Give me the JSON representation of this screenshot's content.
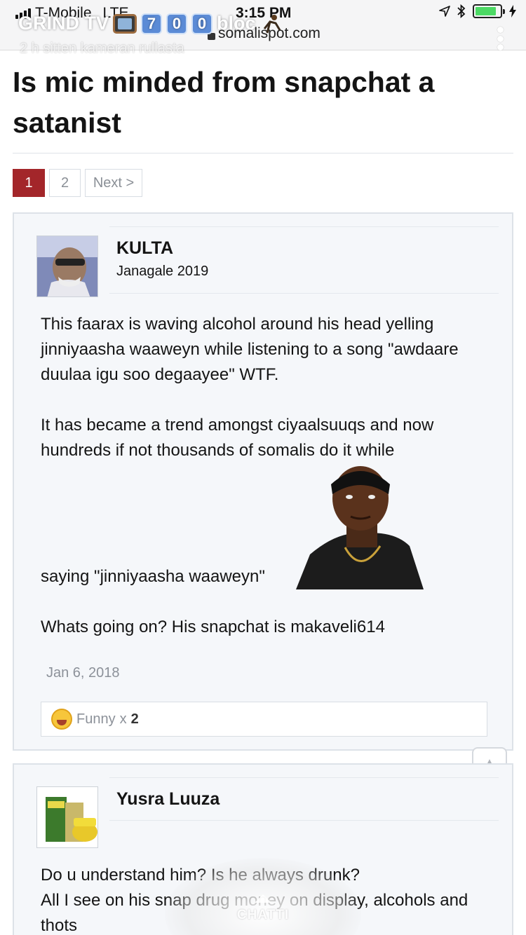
{
  "status_bar": {
    "carrier": "T-Mobile",
    "network": "LTE",
    "time": "3:15 PM",
    "battery_level": 0.85,
    "icons": [
      "location-arrow-icon",
      "bluetooth-icon",
      "battery-icon",
      "charging-bolt-icon"
    ]
  },
  "browser": {
    "url": "somalispot.com",
    "menu_icon": "more-dots-icon"
  },
  "snap_overlay": {
    "title_prefix": "GRIND TV",
    "digits": [
      "7",
      "0",
      "0"
    ],
    "title_suffix": "bloc",
    "subtitle": "2 h sitten kameran rullasta"
  },
  "thread": {
    "title": "Is mic minded from snapchat a satanist"
  },
  "pager": {
    "pages": [
      "1",
      "2"
    ],
    "current": "1",
    "next_label": "Next >"
  },
  "posts": [
    {
      "username": "KULTA",
      "user_title": "Janagale 2019",
      "paragraphs": [
        "This faarax is waving alcohol around his head yelling jinniyaasha waaweyn while listening to a song \"awdaare duulaa igu soo degaayee\" WTF.",
        "It has became a trend amongst ciyaalsuuqs and now hundreds if not thousands of somalis do it while",
        "saying \"jinniyaasha waaweyn\"",
        "Whats going on? His snapchat is makaveli614"
      ],
      "date": "Jan 6, 2018",
      "reaction": {
        "label": "Funny",
        "multiplier": "x",
        "count": "2"
      }
    },
    {
      "username": "Yusra Luuza",
      "user_title": "",
      "paragraphs": [
        "Do u understand him? Is he always drunk?",
        "All I see on his snap drug money on display, alcohols and thots"
      ]
    }
  ],
  "chat_overlay": {
    "label": "CHATTI"
  },
  "colors": {
    "accent": "#a3262a",
    "post_bg": "#f5f7fa",
    "border": "#dde2e8"
  }
}
